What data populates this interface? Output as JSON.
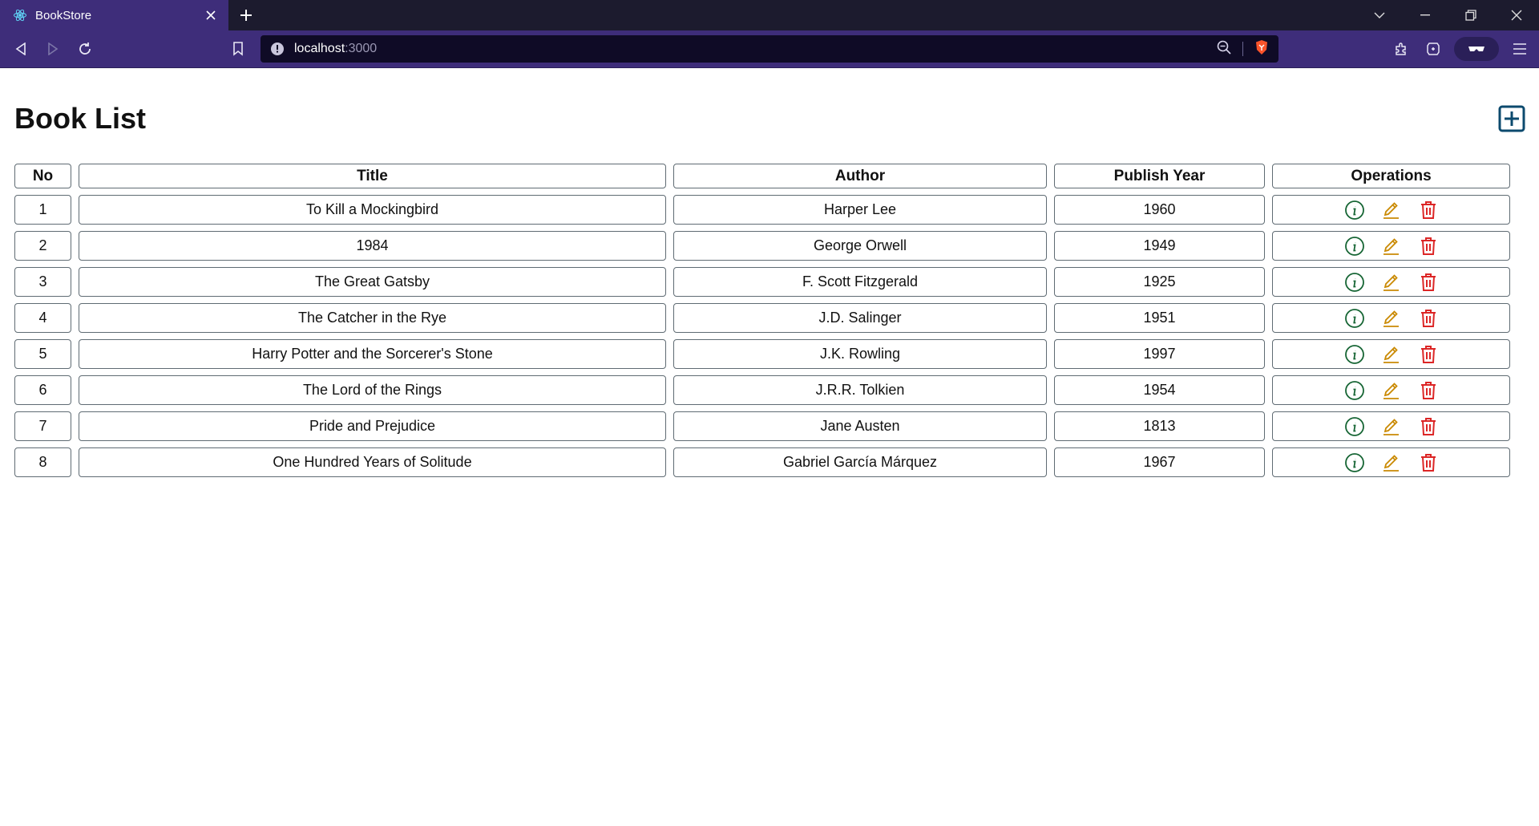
{
  "browser": {
    "tab_title": "BookStore",
    "url_host": "localhost",
    "url_port": ":3000"
  },
  "page": {
    "title": "Book List"
  },
  "table": {
    "headers": [
      "No",
      "Title",
      "Author",
      "Publish Year",
      "Operations"
    ],
    "rows": [
      {
        "no": "1",
        "title": "To Kill a Mockingbird",
        "author": "Harper Lee",
        "year": "1960"
      },
      {
        "no": "2",
        "title": "1984",
        "author": "George Orwell",
        "year": "1949"
      },
      {
        "no": "3",
        "title": "The Great Gatsby",
        "author": "F. Scott Fitzgerald",
        "year": "1925"
      },
      {
        "no": "4",
        "title": "The Catcher in the Rye",
        "author": "J.D. Salinger",
        "year": "1951"
      },
      {
        "no": "5",
        "title": "Harry Potter and the Sorcerer's Stone",
        "author": "J.K. Rowling",
        "year": "1997"
      },
      {
        "no": "6",
        "title": "The Lord of the Rings",
        "author": "J.R.R. Tolkien",
        "year": "1954"
      },
      {
        "no": "7",
        "title": "Pride and Prejudice",
        "author": "Jane Austen",
        "year": "1813"
      },
      {
        "no": "8",
        "title": "One Hundred Years of Solitude",
        "author": "Gabriel García Márquez",
        "year": "1967"
      }
    ]
  },
  "colors": {
    "add": "#0c4a6e",
    "info": "#166534",
    "edit": "#ca8a04",
    "delete": "#dc2626",
    "chrome": "#3e2d7a"
  },
  "icons": {
    "add": "plus-square-icon",
    "info": "info-circle-icon",
    "edit": "pencil-icon",
    "delete": "trash-icon"
  }
}
